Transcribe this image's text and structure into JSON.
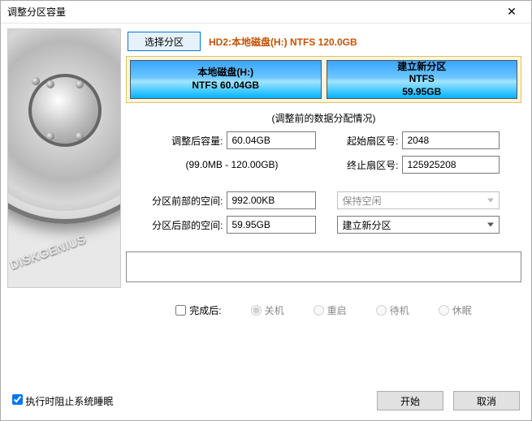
{
  "window": {
    "title": "调整分区容量"
  },
  "brand": "DISKGENIUS",
  "select_partition_label": "选择分区",
  "disk_label": "HD2:本地磁盘(H:) NTFS 120.0GB",
  "partitions": [
    {
      "name": "本地磁盘(H:)",
      "info": "NTFS 60.04GB"
    },
    {
      "name": "建立新分区",
      "info": "NTFS",
      "info2": "59.95GB"
    }
  ],
  "subcaption": "(调整前的数据分配情况)",
  "labels": {
    "size_after": "调整后容量:",
    "start_sector": "起始扇区号:",
    "range": "(99.0MB - 120.00GB)",
    "end_sector": "终止扇区号:",
    "space_before": "分区前部的空间:",
    "space_after": "分区后部的空间:"
  },
  "values": {
    "size_after": "60.04GB",
    "start_sector": "2048",
    "end_sector": "125925208",
    "space_before": "992.00KB",
    "space_after": "59.95GB",
    "combo_before": "保持空闲",
    "combo_after": "建立新分区"
  },
  "after_done": {
    "checkbox_label": "完成后:",
    "options": [
      "关机",
      "重启",
      "待机",
      "休眠"
    ]
  },
  "footer": {
    "prevent_sleep": "执行时阻止系统睡眠",
    "start": "开始",
    "cancel": "取消"
  }
}
